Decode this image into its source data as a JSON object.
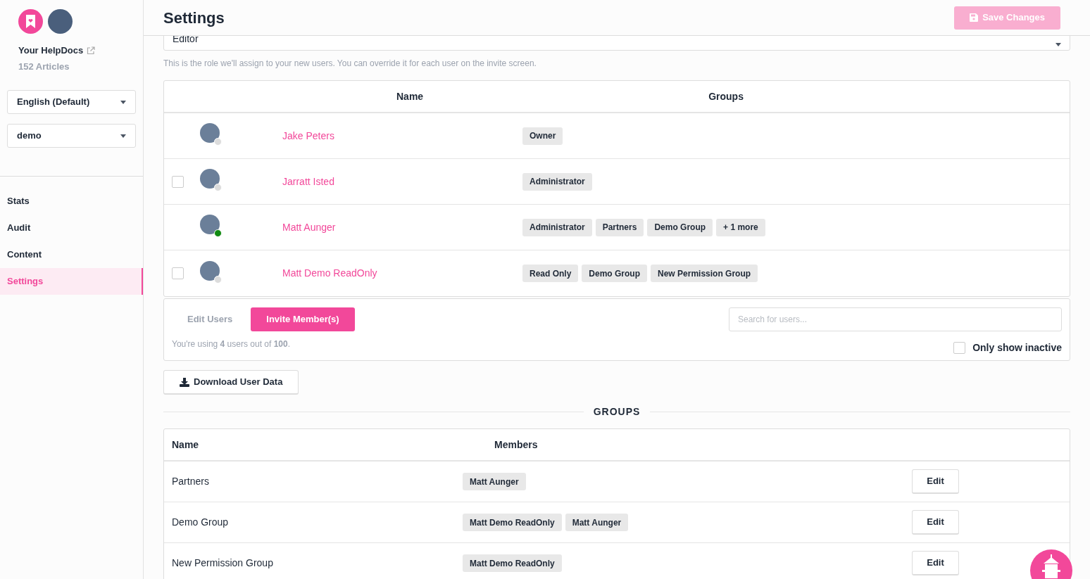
{
  "sidebar": {
    "site_name": "Your HelpDocs",
    "article_count": "152 Articles",
    "language_select": "English (Default)",
    "workspace_select": "demo",
    "nav": [
      {
        "label": "Stats",
        "selected": false
      },
      {
        "label": "Audit",
        "selected": false
      },
      {
        "label": "Content",
        "selected": false
      },
      {
        "label": "Settings",
        "selected": true
      }
    ]
  },
  "header": {
    "title": "Settings",
    "save_button": {
      "label": "Save Changes",
      "disabled": true
    }
  },
  "default_role": {
    "value": "Editor",
    "help": "This is the role we'll assign to your new users. You can override it for each user on the invite screen."
  },
  "users_table": {
    "columns": [
      "Name",
      "Groups"
    ],
    "rows": [
      {
        "name": "Jake Peters",
        "online": false,
        "has_checkbox": false,
        "groups": [
          "Owner"
        ]
      },
      {
        "name": "Jarratt Isted",
        "online": false,
        "has_checkbox": true,
        "checked": false,
        "groups": [
          "Administrator"
        ]
      },
      {
        "name": "Matt Aunger",
        "online": true,
        "has_checkbox": false,
        "groups": [
          "Administrator",
          "Partners",
          "Demo Group",
          "+ 1 more"
        ]
      },
      {
        "name": "Matt Demo ReadOnly",
        "online": false,
        "has_checkbox": true,
        "checked": false,
        "groups": [
          "Read Only",
          "Demo Group",
          "New Permission Group"
        ]
      }
    ]
  },
  "users_footer": {
    "tabs": [
      {
        "label": "Edit Users",
        "selected": false
      },
      {
        "label": "Invite Member(s)",
        "selected": true
      }
    ],
    "usage": "You're using **4** users out of **100**.",
    "search": {
      "placeholder": "Search for users..."
    },
    "only_inactive": {
      "label": "Only show inactive",
      "checked": false
    }
  },
  "download_button": "Download User Data",
  "groups_heading": "GROUPS",
  "groups_table": {
    "columns": [
      "Name",
      "Members"
    ],
    "rows": [
      {
        "name": "Partners",
        "members": [
          "Matt Aunger"
        ],
        "action": "Edit"
      },
      {
        "name": "Demo Group",
        "members": [
          "Matt Demo ReadOnly",
          "Matt Aunger"
        ],
        "action": "Edit"
      },
      {
        "name": "New Permission Group",
        "members": [
          "Matt Demo ReadOnly"
        ],
        "action": "Edit"
      }
    ]
  }
}
